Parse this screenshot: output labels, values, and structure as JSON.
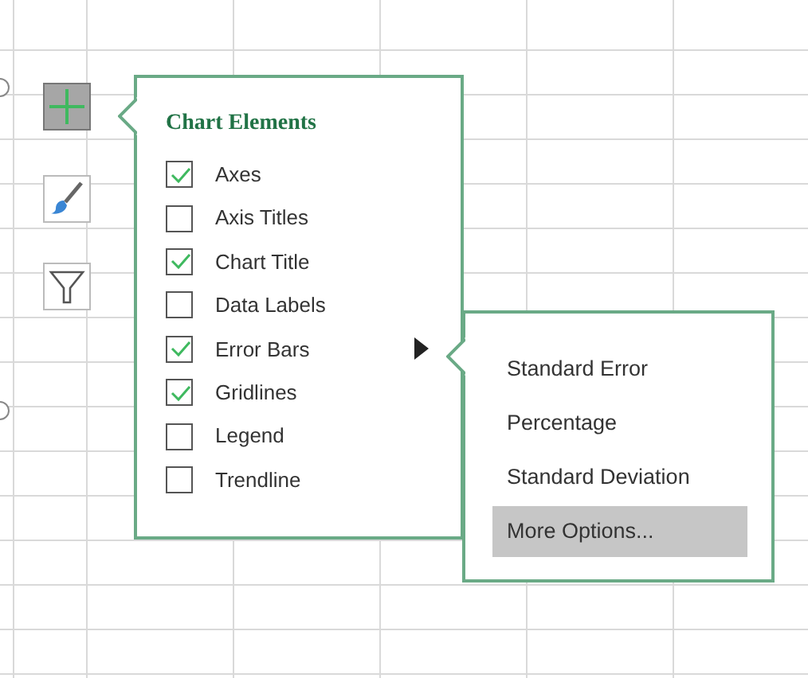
{
  "side_buttons": [
    {
      "kind": "elements",
      "selected": true
    },
    {
      "kind": "styles",
      "selected": false
    },
    {
      "kind": "filter",
      "selected": false
    }
  ],
  "chart_elements": {
    "title": "Chart Elements",
    "items": [
      {
        "label": "Axes",
        "checked": true,
        "has_submenu": false
      },
      {
        "label": "Axis Titles",
        "checked": false,
        "has_submenu": false
      },
      {
        "label": "Chart Title",
        "checked": true,
        "has_submenu": false
      },
      {
        "label": "Data Labels",
        "checked": false,
        "has_submenu": false
      },
      {
        "label": "Error Bars",
        "checked": true,
        "has_submenu": true
      },
      {
        "label": "Gridlines",
        "checked": true,
        "has_submenu": false
      },
      {
        "label": "Legend",
        "checked": false,
        "has_submenu": false
      },
      {
        "label": "Trendline",
        "checked": false,
        "has_submenu": false
      }
    ]
  },
  "submenu": {
    "items": [
      {
        "label": "Standard Error",
        "selected": false
      },
      {
        "label": "Percentage",
        "selected": false
      },
      {
        "label": "Standard Deviation",
        "selected": false
      },
      {
        "label": "More Options...",
        "selected": true
      }
    ]
  }
}
